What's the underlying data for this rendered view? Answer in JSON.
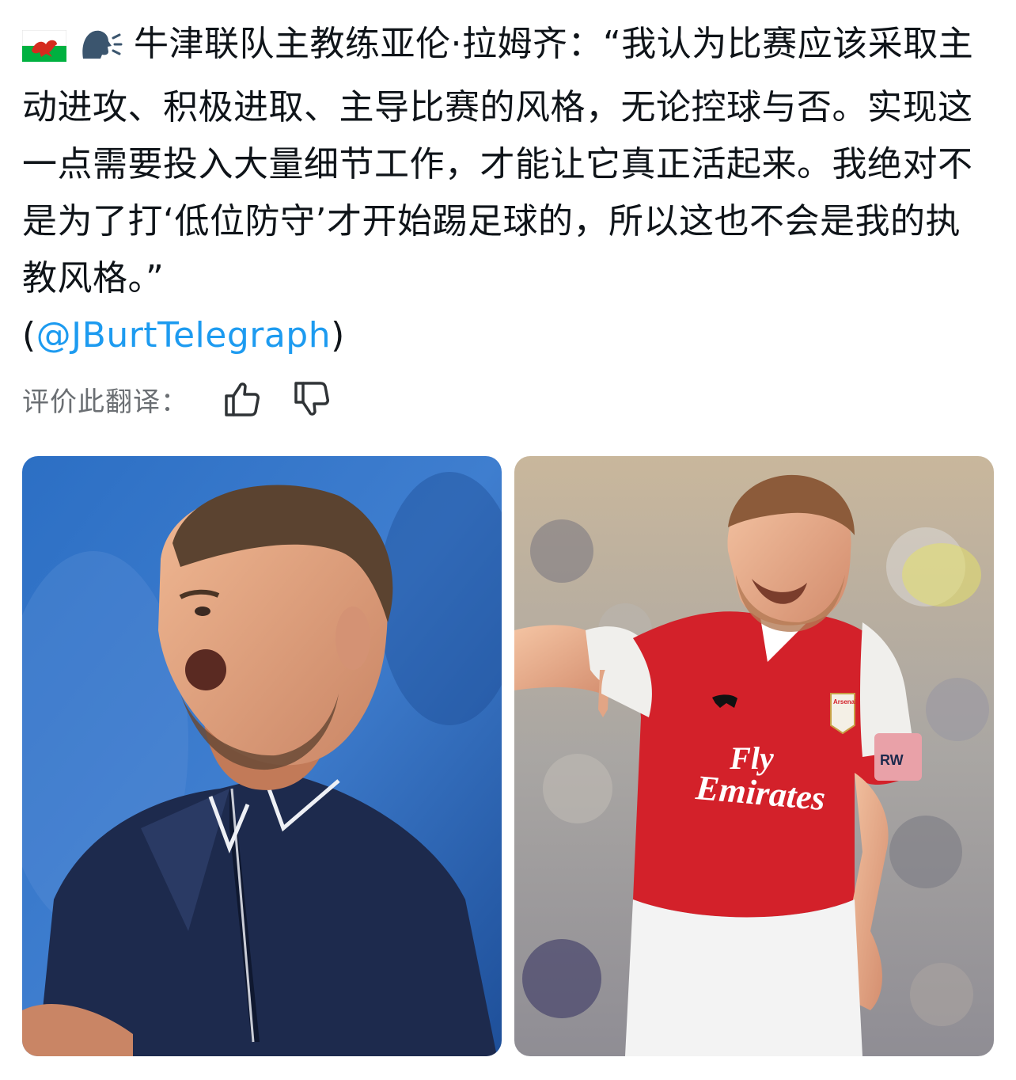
{
  "tweet": {
    "flag_icon": "wales-flag-icon",
    "speaking_icon": "speaking-head-icon",
    "text": "牛津联队主教练亚伦·拉姆齐：“我认为比赛应该采取主动进攻、积极进取、主导比赛的风格，无论控球与否。实现这一点需要投入大量细节工作，才能让它真正活起来。我绝对不是为了打‘低位防守’才开始踢足球的，所以这也不会是我的执教风格。”",
    "mention_open": "(",
    "mention": "@JBurtTelegraph",
    "mention_close": ")"
  },
  "rate": {
    "label": "评价此翻译：",
    "up_icon": "thumbs-up-icon",
    "down_icon": "thumbs-down-icon"
  },
  "media": {
    "left_alt": "coach-photo",
    "right_alt": "player-photo",
    "shirt_text_line1": "Fly",
    "shirt_text_line2": "Emirates",
    "crest_text": "Arsenal",
    "armband_text": "RW"
  },
  "colors": {
    "mention": "#1d9bf0",
    "secondary": "#6b6f73",
    "left_bg": "#2a66b8",
    "shirt_red": "#d3212a",
    "polo_navy": "#1d2a4d"
  }
}
